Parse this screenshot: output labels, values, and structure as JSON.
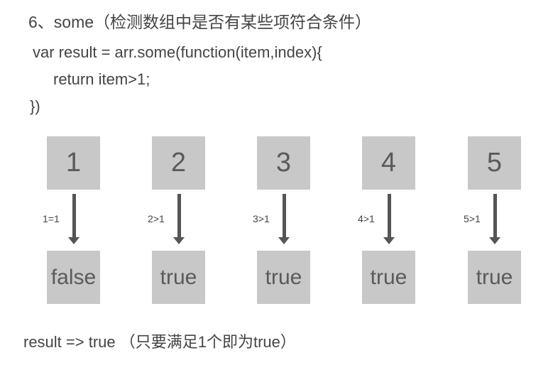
{
  "title": "6、some（检测数组中是否有某些项符合条件）",
  "code": [
    "var result = arr.some(function(item,index){",
    "return item>1;",
    "})"
  ],
  "items": [
    {
      "value": "1",
      "compare": "1=1",
      "result": "false"
    },
    {
      "value": "2",
      "compare": "2>1",
      "result": "true"
    },
    {
      "value": "3",
      "compare": "3>1",
      "result": "true"
    },
    {
      "value": "4",
      "compare": "4>1",
      "result": "true"
    },
    {
      "value": "5",
      "compare": "5>1",
      "result": "true"
    }
  ],
  "result_line": "result => true （只要满足1个即为true）"
}
